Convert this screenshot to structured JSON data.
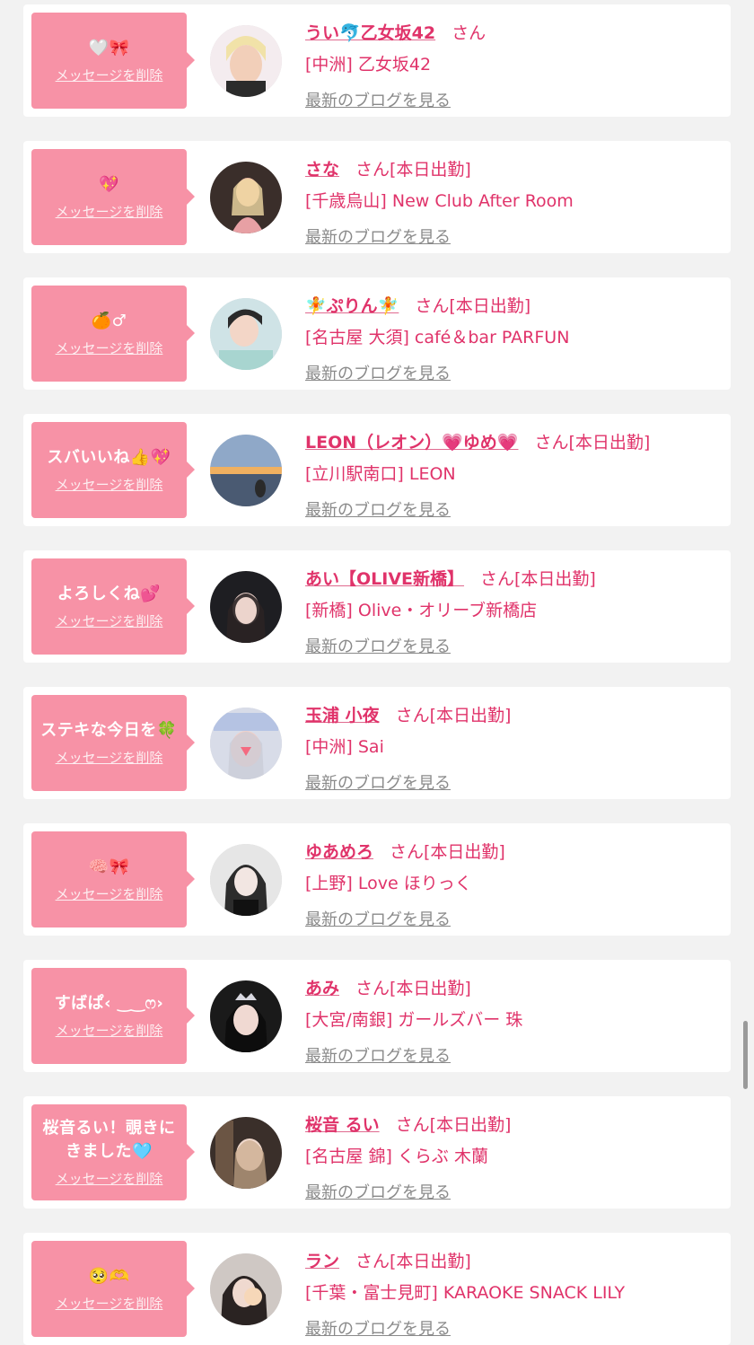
{
  "delete_label": "メッセージを削除",
  "blog_label": "最新のブログを見る",
  "cards": [
    {
      "message": "🤍🎀",
      "name": "うい🐬乙女坂42",
      "suffix": "さん",
      "shop": "[中洲] 乙女坂42"
    },
    {
      "message": "💖",
      "name": "さな",
      "suffix": "さん[本日出勤]",
      "shop": "[千歳烏山] New Club After Room"
    },
    {
      "message": "🍊♂",
      "name": "🧚ぷりん🧚",
      "suffix": "さん[本日出勤]",
      "shop": "[名古屋 大須] café＆bar PARFUN"
    },
    {
      "message": "スバいいね👍💖",
      "name": "LEON（レオン）💗ゆめ💗",
      "suffix": "さん[本日出勤]",
      "shop": "[立川駅南口] LEON"
    },
    {
      "message": "よろしくね💕",
      "name": "あい【OLIVE新橋】",
      "suffix": "さん[本日出勤]",
      "shop": "[新橋] Olive・オリーブ新橋店"
    },
    {
      "message": "ステキな今日を🍀",
      "name": "玉浦 小夜",
      "suffix": "さん[本日出勤]",
      "shop": "[中洲] Sai"
    },
    {
      "message": "🧠🎀",
      "name": "ゆあめろ",
      "suffix": "さん[本日出勤]",
      "shop": "[上野] Love ほりっく"
    },
    {
      "message": "すばぱ‹ ‿‿ෆ›",
      "name": "あみ",
      "suffix": "さん[本日出勤]",
      "shop": "[大宮/南銀] ガールズバー 珠"
    },
    {
      "message": "桜音るい！覗きにきました🩵",
      "name": "桜音 るい",
      "suffix": "さん[本日出勤]",
      "shop": "[名古屋 錦] くらぶ 木蘭"
    },
    {
      "message": "🥺🫶",
      "name": "ラン",
      "suffix": "さん[本日出勤]",
      "shop": "[千葉・富士見町] KARAOKE SNACK LILY"
    }
  ]
}
